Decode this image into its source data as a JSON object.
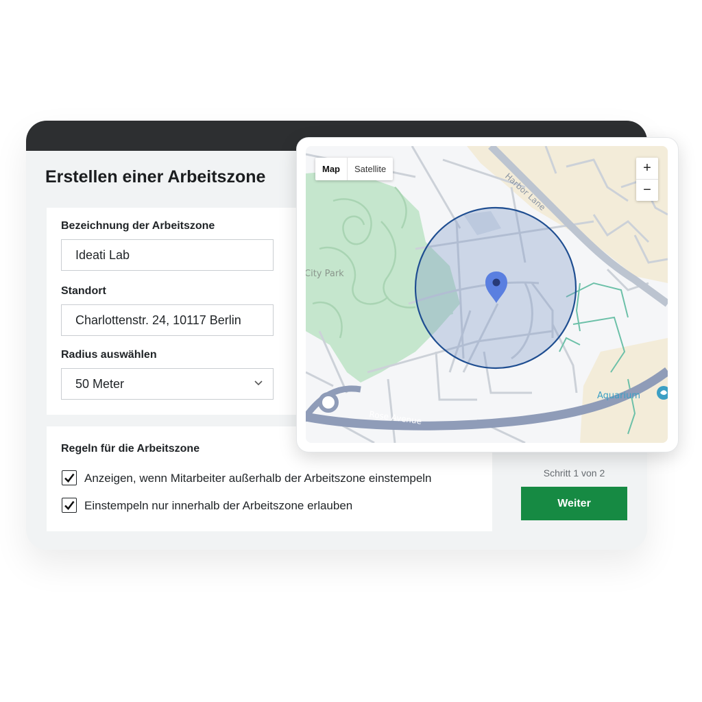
{
  "form": {
    "title": "Erstellen einer Arbeitszone",
    "name_label": "Bezeichnung der Arbeitszone",
    "name_value": "Ideati Lab",
    "location_label": "Standort",
    "location_value": "Charlottenstr. 24, 10117 Berlin",
    "radius_label": "Radius auswählen",
    "radius_value": "50 Meter"
  },
  "rules": {
    "title": "Regeln für die Arbeitszone",
    "items": [
      {
        "label": "Anzeigen, wenn Mitarbeiter außerhalb der Arbeitszone einstempeln",
        "checked": true
      },
      {
        "label": "Einstempeln nur innerhalb der Arbeitszone erlauben",
        "checked": true
      }
    ]
  },
  "footer": {
    "step_text": "Schritt 1 von 2",
    "next_label": "Weiter",
    "accent_color": "#168a43"
  },
  "map": {
    "type_map": "Map",
    "type_satellite": "Satellite",
    "zoom_in": "+",
    "zoom_out": "−",
    "labels": {
      "city_park": "City Park",
      "harbor_lane": "Harbor Lane",
      "rose_avenue": "Rose Avenue",
      "aquarium": "Aquarium"
    },
    "marker_icon": "location-pin-icon",
    "radius_color": "#1f4e91"
  }
}
